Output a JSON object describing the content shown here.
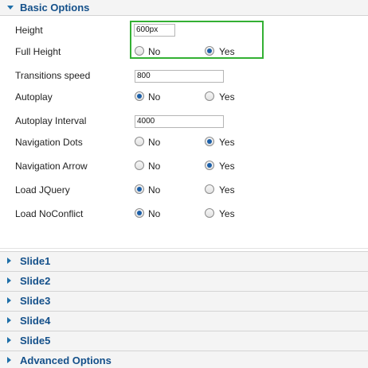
{
  "basic_options": {
    "title": "Basic Options",
    "fields": [
      {
        "label": "Height",
        "type": "text",
        "value": "600px"
      },
      {
        "label": "Full Height",
        "type": "radio",
        "options": [
          "No",
          "Yes"
        ],
        "selected": "Yes"
      },
      {
        "label": "Transitions speed",
        "type": "text",
        "value": "800"
      },
      {
        "label": "Autoplay",
        "type": "radio",
        "options": [
          "No",
          "Yes"
        ],
        "selected": "No"
      },
      {
        "label": "Autoplay Interval",
        "type": "text",
        "value": "4000"
      },
      {
        "label": "Navigation Dots",
        "type": "radio",
        "options": [
          "No",
          "Yes"
        ],
        "selected": "Yes"
      },
      {
        "label": "Navigation Arrow",
        "type": "radio",
        "options": [
          "No",
          "Yes"
        ],
        "selected": "Yes"
      },
      {
        "label": "Load JQuery",
        "type": "radio",
        "options": [
          "No",
          "Yes"
        ],
        "selected": "No"
      },
      {
        "label": "Load NoConflict",
        "type": "radio",
        "options": [
          "No",
          "Yes"
        ],
        "selected": "No"
      }
    ]
  },
  "collapsed_panels": [
    "Slide1",
    "Slide2",
    "Slide3",
    "Slide4",
    "Slide5",
    "Advanced Options"
  ],
  "colors": {
    "accent": "#14508a",
    "highlight": "#33b033"
  }
}
